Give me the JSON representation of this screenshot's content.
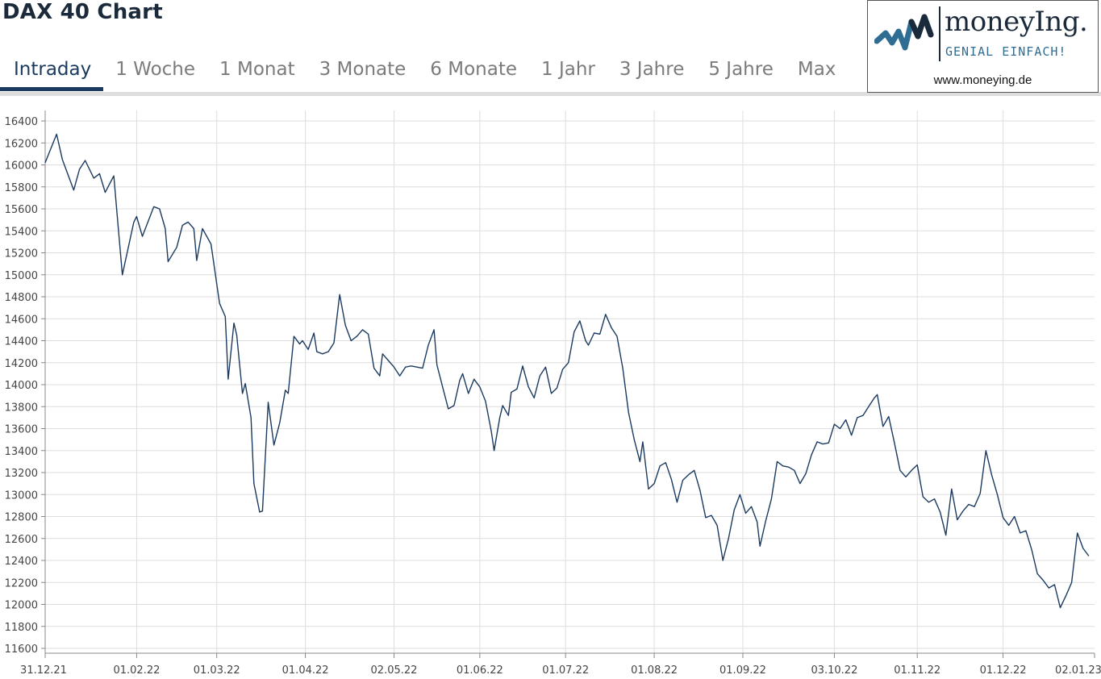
{
  "header": {
    "title": "DAX 40 Chart",
    "tabs": [
      "Intraday",
      "1 Woche",
      "1 Monat",
      "3 Monate",
      "6 Monate",
      "1 Jahr",
      "3 Jahre",
      "5 Jahre",
      "Max"
    ],
    "active_tab": "Intraday"
  },
  "logo": {
    "name": "moneyIng.",
    "tagline": "GENIAL EINFACH!",
    "url": "www.moneying.de",
    "icon": "waveform-logo-icon"
  },
  "colors": {
    "line": "#1b3a60",
    "active_tab": "#1b3a60",
    "grid": "#dedede",
    "logo_accent": "#2f6d93"
  },
  "chart_data": {
    "type": "line",
    "title": "",
    "xlabel": "",
    "ylabel": "",
    "ylim": [
      11600,
      16400
    ],
    "yticks": [
      11600,
      11800,
      12000,
      12200,
      12400,
      12600,
      12800,
      13000,
      13200,
      13400,
      13600,
      13800,
      14000,
      14200,
      14400,
      14600,
      14800,
      15000,
      15200,
      15400,
      15600,
      15800,
      16000,
      16200,
      16400
    ],
    "xlim": [
      "2021-12-31",
      "2023-01-02"
    ],
    "xticks": [
      {
        "date": "2021-12-31",
        "label": "31.12.21"
      },
      {
        "date": "2022-02-01",
        "label": "01.02.22"
      },
      {
        "date": "2022-03-01",
        "label": "01.03.22"
      },
      {
        "date": "2022-04-01",
        "label": "01.04.22"
      },
      {
        "date": "2022-05-02",
        "label": "02.05.22"
      },
      {
        "date": "2022-06-01",
        "label": "01.06.22"
      },
      {
        "date": "2022-07-01",
        "label": "01.07.22"
      },
      {
        "date": "2022-08-01",
        "label": "01.08.22"
      },
      {
        "date": "2022-09-01",
        "label": "01.09.22"
      },
      {
        "date": "2022-10-03",
        "label": "03.10.22"
      },
      {
        "date": "2022-11-01",
        "label": "01.11.22"
      },
      {
        "date": "2022-12-01",
        "label": "01.12.22"
      },
      {
        "date": "2023-01-02",
        "label": "02.01.23"
      }
    ],
    "grid": true,
    "legend": "none",
    "series": [
      {
        "points": [
          [
            "2021-12-31",
            16020
          ],
          [
            "2022-01-04",
            16280
          ],
          [
            "2022-01-06",
            16050
          ],
          [
            "2022-01-10",
            15770
          ],
          [
            "2022-01-12",
            15960
          ],
          [
            "2022-01-14",
            16040
          ],
          [
            "2022-01-17",
            15880
          ],
          [
            "2022-01-19",
            15920
          ],
          [
            "2022-01-21",
            15750
          ],
          [
            "2022-01-24",
            15900
          ],
          [
            "2022-01-25",
            15600
          ],
          [
            "2022-01-27",
            15000
          ],
          [
            "2022-01-31",
            15480
          ],
          [
            "2022-02-01",
            15530
          ],
          [
            "2022-02-03",
            15350
          ],
          [
            "2022-02-07",
            15620
          ],
          [
            "2022-02-09",
            15600
          ],
          [
            "2022-02-11",
            15420
          ],
          [
            "2022-02-12",
            15120
          ],
          [
            "2022-02-15",
            15250
          ],
          [
            "2022-02-17",
            15450
          ],
          [
            "2022-02-19",
            15480
          ],
          [
            "2022-02-21",
            15420
          ],
          [
            "2022-02-22",
            15130
          ],
          [
            "2022-02-24",
            15420
          ],
          [
            "2022-02-27",
            15280
          ],
          [
            "2022-03-02",
            14740
          ],
          [
            "2022-03-04",
            14620
          ],
          [
            "2022-03-05",
            14050
          ],
          [
            "2022-03-07",
            14560
          ],
          [
            "2022-03-08",
            14450
          ],
          [
            "2022-03-10",
            13920
          ],
          [
            "2022-03-11",
            14010
          ],
          [
            "2022-03-13",
            13700
          ],
          [
            "2022-03-14",
            13100
          ],
          [
            "2022-03-16",
            12840
          ],
          [
            "2022-03-17",
            12850
          ],
          [
            "2022-03-19",
            13840
          ],
          [
            "2022-03-21",
            13450
          ],
          [
            "2022-03-23",
            13650
          ],
          [
            "2022-03-25",
            13950
          ],
          [
            "2022-03-26",
            13920
          ],
          [
            "2022-03-28",
            14440
          ],
          [
            "2022-03-30",
            14370
          ],
          [
            "2022-03-31",
            14400
          ],
          [
            "2022-04-02",
            14320
          ],
          [
            "2022-04-04",
            14470
          ],
          [
            "2022-04-05",
            14300
          ],
          [
            "2022-04-07",
            14280
          ],
          [
            "2022-04-09",
            14300
          ],
          [
            "2022-04-11",
            14380
          ],
          [
            "2022-04-13",
            14820
          ],
          [
            "2022-04-15",
            14540
          ],
          [
            "2022-04-17",
            14400
          ],
          [
            "2022-04-19",
            14440
          ],
          [
            "2022-04-21",
            14500
          ],
          [
            "2022-04-23",
            14460
          ],
          [
            "2022-04-25",
            14150
          ],
          [
            "2022-04-27",
            14080
          ],
          [
            "2022-04-28",
            14280
          ],
          [
            "2022-04-30",
            14220
          ],
          [
            "2022-05-02",
            14160
          ],
          [
            "2022-05-04",
            14080
          ],
          [
            "2022-05-06",
            14160
          ],
          [
            "2022-05-08",
            14170
          ],
          [
            "2022-05-10",
            14160
          ],
          [
            "2022-05-12",
            14150
          ],
          [
            "2022-05-14",
            14360
          ],
          [
            "2022-05-16",
            14500
          ],
          [
            "2022-05-17",
            14180
          ],
          [
            "2022-05-19",
            13980
          ],
          [
            "2022-05-21",
            13780
          ],
          [
            "2022-05-23",
            13810
          ],
          [
            "2022-05-25",
            14040
          ],
          [
            "2022-05-26",
            14100
          ],
          [
            "2022-05-28",
            13920
          ],
          [
            "2022-05-30",
            14050
          ],
          [
            "2022-06-01",
            13980
          ],
          [
            "2022-06-03",
            13850
          ],
          [
            "2022-06-05",
            13580
          ],
          [
            "2022-06-06",
            13400
          ],
          [
            "2022-06-08",
            13700
          ],
          [
            "2022-06-09",
            13810
          ],
          [
            "2022-06-11",
            13720
          ],
          [
            "2022-06-12",
            13930
          ],
          [
            "2022-06-14",
            13960
          ],
          [
            "2022-06-16",
            14170
          ],
          [
            "2022-06-18",
            13980
          ],
          [
            "2022-06-20",
            13880
          ],
          [
            "2022-06-22",
            14080
          ],
          [
            "2022-06-24",
            14160
          ],
          [
            "2022-06-26",
            13920
          ],
          [
            "2022-06-28",
            13970
          ],
          [
            "2022-06-30",
            14140
          ],
          [
            "2022-07-02",
            14200
          ],
          [
            "2022-07-04",
            14480
          ],
          [
            "2022-07-06",
            14580
          ],
          [
            "2022-07-08",
            14400
          ],
          [
            "2022-07-09",
            14360
          ],
          [
            "2022-07-11",
            14470
          ],
          [
            "2022-07-13",
            14460
          ],
          [
            "2022-07-15",
            14640
          ],
          [
            "2022-07-17",
            14520
          ],
          [
            "2022-07-19",
            14440
          ],
          [
            "2022-07-21",
            14150
          ],
          [
            "2022-07-23",
            13750
          ],
          [
            "2022-07-25",
            13500
          ],
          [
            "2022-07-27",
            13300
          ],
          [
            "2022-07-28",
            13480
          ],
          [
            "2022-07-30",
            13050
          ],
          [
            "2022-08-01",
            13100
          ],
          [
            "2022-08-03",
            13260
          ],
          [
            "2022-08-05",
            13290
          ],
          [
            "2022-08-07",
            13140
          ],
          [
            "2022-08-09",
            12930
          ],
          [
            "2022-08-11",
            13130
          ],
          [
            "2022-08-13",
            13180
          ],
          [
            "2022-08-15",
            13220
          ],
          [
            "2022-08-17",
            13040
          ],
          [
            "2022-08-19",
            12790
          ],
          [
            "2022-08-21",
            12810
          ],
          [
            "2022-08-23",
            12720
          ],
          [
            "2022-08-25",
            12400
          ],
          [
            "2022-08-27",
            12600
          ],
          [
            "2022-08-29",
            12860
          ],
          [
            "2022-08-31",
            13000
          ],
          [
            "2022-09-02",
            12830
          ],
          [
            "2022-09-04",
            12890
          ],
          [
            "2022-09-06",
            12750
          ],
          [
            "2022-09-07",
            12530
          ],
          [
            "2022-09-09",
            12760
          ],
          [
            "2022-09-11",
            12960
          ],
          [
            "2022-09-13",
            13300
          ],
          [
            "2022-09-15",
            13260
          ],
          [
            "2022-09-17",
            13250
          ],
          [
            "2022-09-19",
            13220
          ],
          [
            "2022-09-21",
            13100
          ],
          [
            "2022-09-23",
            13190
          ],
          [
            "2022-09-25",
            13360
          ],
          [
            "2022-09-27",
            13480
          ],
          [
            "2022-09-29",
            13460
          ],
          [
            "2022-10-01",
            13470
          ],
          [
            "2022-10-03",
            13640
          ],
          [
            "2022-10-05",
            13600
          ],
          [
            "2022-10-07",
            13680
          ],
          [
            "2022-10-09",
            13540
          ],
          [
            "2022-10-11",
            13700
          ],
          [
            "2022-10-13",
            13720
          ],
          [
            "2022-10-15",
            13800
          ],
          [
            "2022-10-17",
            13880
          ],
          [
            "2022-10-18",
            13910
          ],
          [
            "2022-10-20",
            13620
          ],
          [
            "2022-10-22",
            13710
          ],
          [
            "2022-10-24",
            13470
          ],
          [
            "2022-10-26",
            13220
          ],
          [
            "2022-10-28",
            13160
          ],
          [
            "2022-10-30",
            13220
          ],
          [
            "2022-11-01",
            13270
          ],
          [
            "2022-11-03",
            12980
          ],
          [
            "2022-11-05",
            12930
          ],
          [
            "2022-11-07",
            12960
          ],
          [
            "2022-11-09",
            12840
          ],
          [
            "2022-11-11",
            12630
          ],
          [
            "2022-11-13",
            13050
          ],
          [
            "2022-11-15",
            12770
          ],
          [
            "2022-11-17",
            12850
          ],
          [
            "2022-11-19",
            12910
          ],
          [
            "2022-11-21",
            12890
          ],
          [
            "2022-11-23",
            13010
          ],
          [
            "2022-11-25",
            13400
          ],
          [
            "2022-11-27",
            13180
          ],
          [
            "2022-11-29",
            13000
          ],
          [
            "2022-12-01",
            12790
          ],
          [
            "2022-12-03",
            12720
          ],
          [
            "2022-12-05",
            12800
          ],
          [
            "2022-12-07",
            12650
          ],
          [
            "2022-12-09",
            12670
          ],
          [
            "2022-12-11",
            12500
          ],
          [
            "2022-12-13",
            12280
          ],
          [
            "2022-12-15",
            12220
          ],
          [
            "2022-12-17",
            12150
          ],
          [
            "2022-12-19",
            12180
          ],
          [
            "2022-12-21",
            11970
          ],
          [
            "2022-12-23",
            12080
          ],
          [
            "2022-12-25",
            12200
          ],
          [
            "2022-12-27",
            12650
          ],
          [
            "2022-12-29",
            12510
          ],
          [
            "2022-12-31",
            12440
          ]
        ]
      }
    ]
  }
}
